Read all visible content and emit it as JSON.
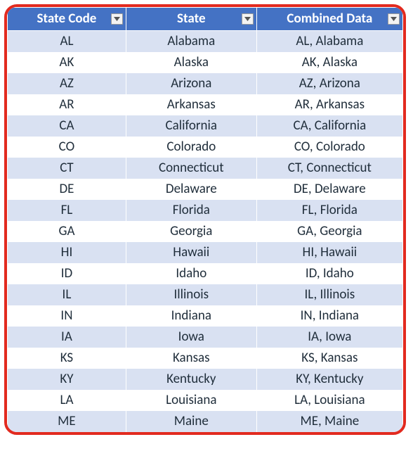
{
  "headers": {
    "col1": "State Code",
    "col2": "State",
    "col3": "Combined Data"
  },
  "rows": [
    {
      "code": "AL",
      "state": "Alabama",
      "combined": "AL, Alabama"
    },
    {
      "code": "AK",
      "state": "Alaska",
      "combined": "AK, Alaska"
    },
    {
      "code": "AZ",
      "state": "Arizona",
      "combined": "AZ, Arizona"
    },
    {
      "code": "AR",
      "state": "Arkansas",
      "combined": "AR, Arkansas"
    },
    {
      "code": "CA",
      "state": "California",
      "combined": "CA, California"
    },
    {
      "code": "CO",
      "state": "Colorado",
      "combined": "CO, Colorado"
    },
    {
      "code": "CT",
      "state": "Connecticut",
      "combined": "CT, Connecticut"
    },
    {
      "code": "DE",
      "state": "Delaware",
      "combined": "DE, Delaware"
    },
    {
      "code": "FL",
      "state": "Florida",
      "combined": "FL, Florida"
    },
    {
      "code": "GA",
      "state": "Georgia",
      "combined": "GA, Georgia"
    },
    {
      "code": "HI",
      "state": "Hawaii",
      "combined": "HI, Hawaii"
    },
    {
      "code": "ID",
      "state": "Idaho",
      "combined": "ID, Idaho"
    },
    {
      "code": "IL",
      "state": "Illinois",
      "combined": "IL, Illinois"
    },
    {
      "code": "IN",
      "state": "Indiana",
      "combined": "IN, Indiana"
    },
    {
      "code": "IA",
      "state": "Iowa",
      "combined": "IA, Iowa"
    },
    {
      "code": "KS",
      "state": "Kansas",
      "combined": "KS, Kansas"
    },
    {
      "code": "KY",
      "state": "Kentucky",
      "combined": "KY, Kentucky"
    },
    {
      "code": "LA",
      "state": "Louisiana",
      "combined": "LA, Louisiana"
    },
    {
      "code": "ME",
      "state": "Maine",
      "combined": "ME, Maine"
    }
  ],
  "icons": {
    "filter": "dropdown-arrow-icon"
  }
}
